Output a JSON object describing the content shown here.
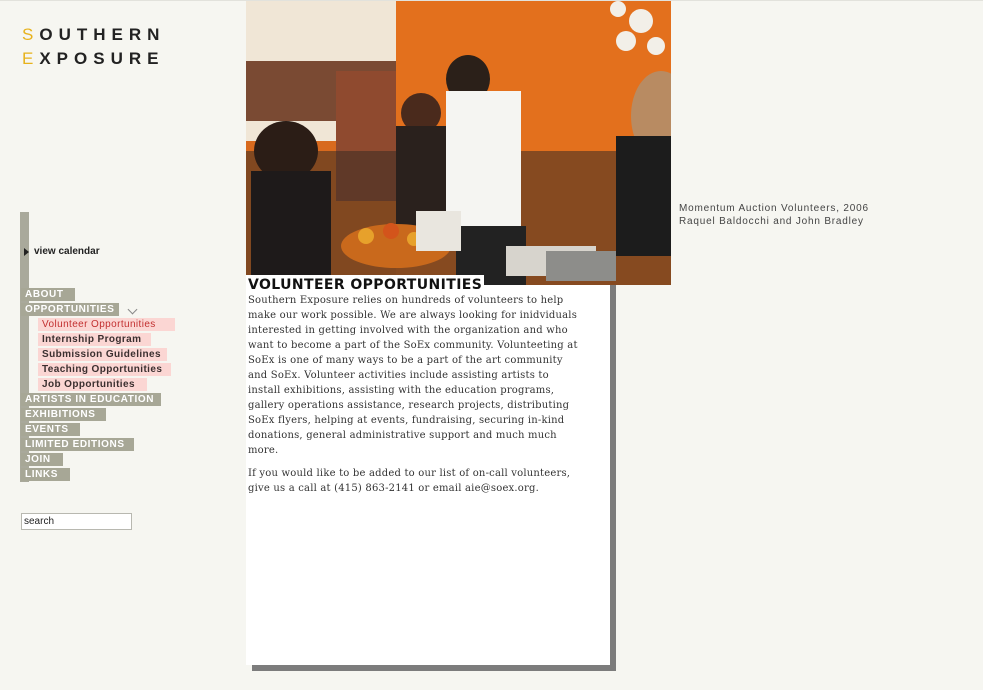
{
  "logo": {
    "line1_accent": "S",
    "line1_rest": "OUTHERN",
    "line2_accent": "E",
    "line2_rest": "XPOSURE",
    "accent_color": "#e7b21c"
  },
  "nav": {
    "calendar_label": "view calendar",
    "items": [
      {
        "label": "ABOUT"
      },
      {
        "label": "OPPORTUNITIES"
      },
      {
        "label": "ARTISTS IN EDUCATION"
      },
      {
        "label": "EXHIBITIONS"
      },
      {
        "label": "EVENTS"
      },
      {
        "label": "LIMITED EDITIONS"
      },
      {
        "label": "JOIN"
      },
      {
        "label": "LINKS"
      }
    ],
    "subitems": [
      {
        "label": "Volunteer Opportunities",
        "active": true
      },
      {
        "label": "Internship Program"
      },
      {
        "label": "Submission Guidelines"
      },
      {
        "label": "Teaching Opportunities"
      },
      {
        "label": "Job Opportunities"
      }
    ],
    "search_value": "search"
  },
  "photo": {
    "caption_line1": "Momentum Auction Volunteers, 2006",
    "caption_line2": "Raquel Baldocchi and John Bradley"
  },
  "content": {
    "title": "VOLUNTEER OPPORTUNITIES",
    "paragraph1": "Southern Exposure relies on hundreds of volunteers to help make our work possible. We are always looking for inidviduals interested in getting involved with the organization and who want to become a part of the SoEx community. Volunteeting at SoEx is one of many ways to be a part of the art community and SoEx. Volunteer activities include assisting artists to  install exhibitions, assisting with the education programs, gallery operations assistance, research projects, distributing SoEx flyers, helping at events, fundraising, securing in-kind donations, general administrative support and much much more.",
    "paragraph2": "If you would like to be added to our list of on-call volunteers, give us a call at (415) 863-2141 or email aie@soex.org."
  }
}
